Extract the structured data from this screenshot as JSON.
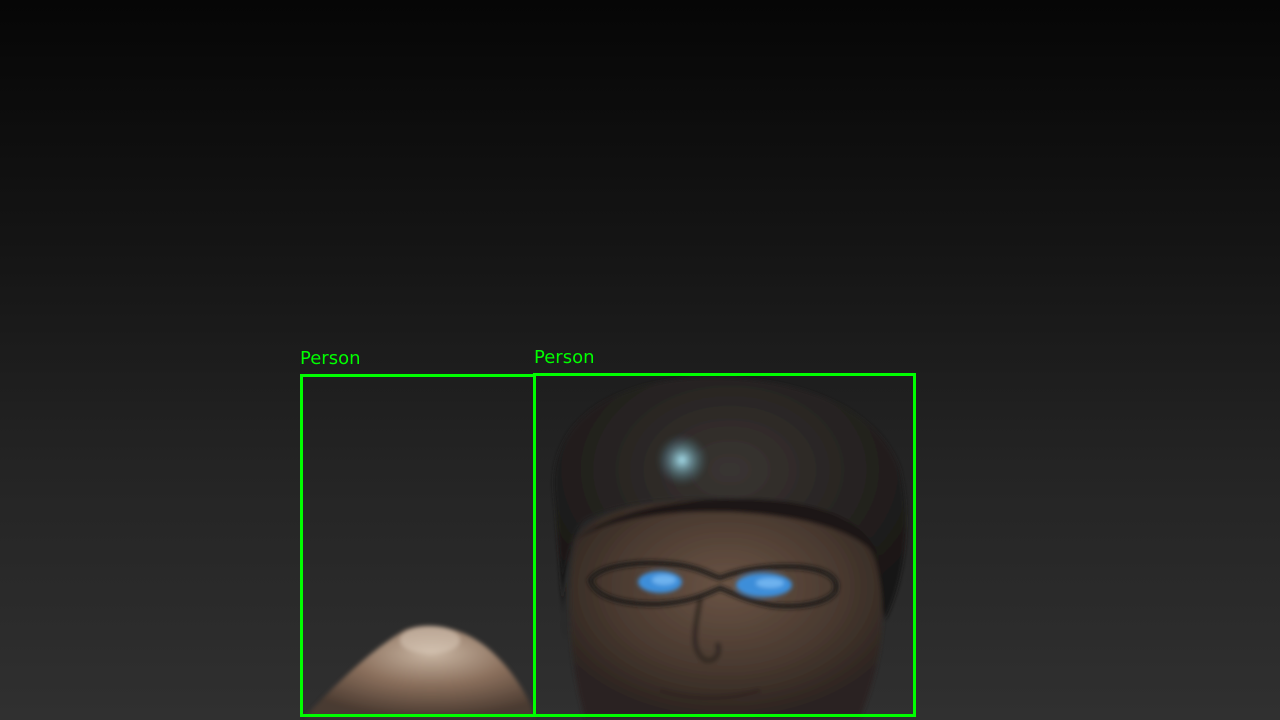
{
  "detections": [
    {
      "label": "Person"
    },
    {
      "label": "Person"
    }
  ],
  "colors": {
    "box": "#00ff00",
    "background_top": "#060606",
    "background_bottom": "#303030"
  }
}
